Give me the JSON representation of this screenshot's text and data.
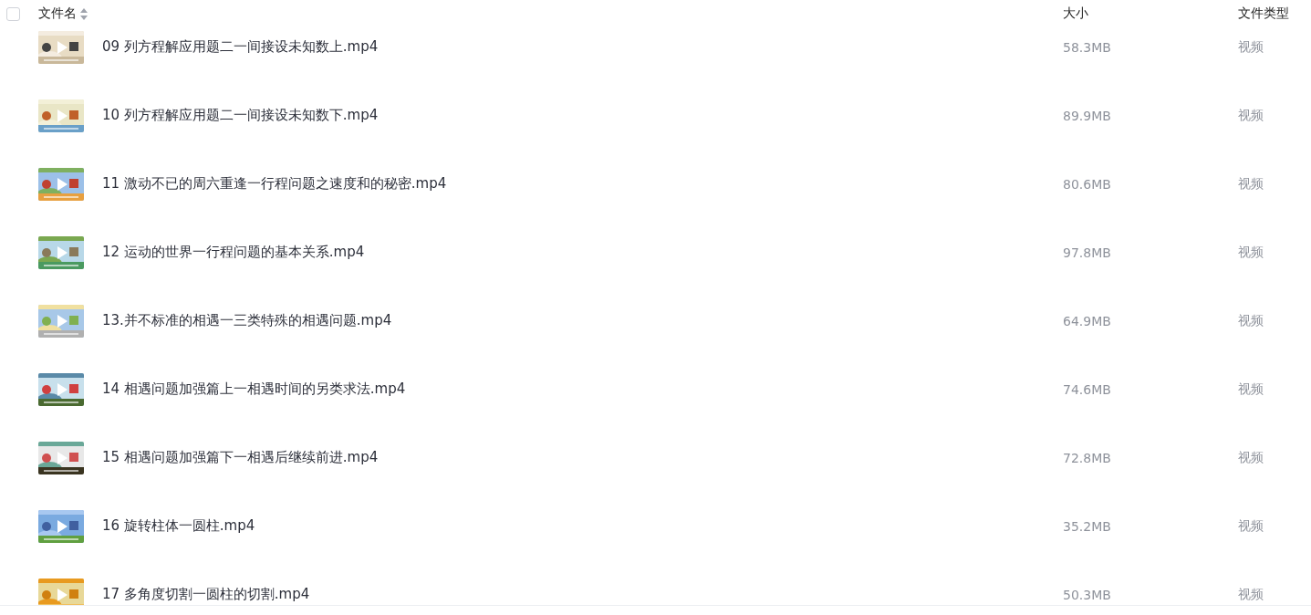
{
  "header": {
    "checked": false,
    "columns": [
      "文件名",
      "大小",
      "文件类型"
    ]
  },
  "files": [
    {
      "name": "09 列方程解应用题二一间接设未知数上.mp4",
      "size": "58.3MB",
      "type": "视频",
      "kind": "picture"
    },
    {
      "name": "10 列方程解应用题二一间接设未知数下.mp4",
      "size": "89.9MB",
      "type": "视频",
      "kind": "picture"
    },
    {
      "name": "11 激动不已的周六重逢一行程问题之速度和的秘密.mp4",
      "size": "80.6MB",
      "type": "视频",
      "kind": "picture"
    },
    {
      "name": "12 运动的世界一行程问题的基本关系.mp4",
      "size": "97.8MB",
      "type": "视频",
      "kind": "picture"
    },
    {
      "name": "13.并不标准的相遇一三类特殊的相遇问题.mp4",
      "size": "64.9MB",
      "type": "视频",
      "kind": "picture"
    },
    {
      "name": "14 相遇问题加强篇上一相遇时间的另类求法.mp4",
      "size": "74.6MB",
      "type": "视频",
      "kind": "picture"
    },
    {
      "name": "15 相遇问题加强篇下一相遇后继续前进.mp4",
      "size": "72.8MB",
      "type": "视频",
      "kind": "picture"
    },
    {
      "name": "16 旋转柱体一圆柱.mp4",
      "size": "35.2MB",
      "type": "视频",
      "kind": "picture"
    },
    {
      "name": "17 多角度切割一圆柱的切割.mp4",
      "size": "50.3MB",
      "type": "视频",
      "kind": "picture"
    }
  ]
}
